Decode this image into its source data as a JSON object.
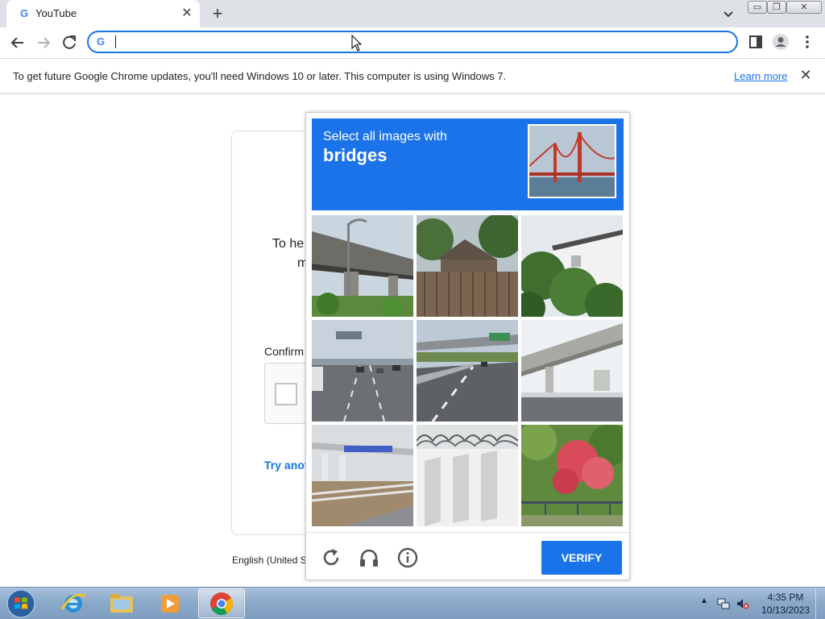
{
  "browser": {
    "tab": {
      "title": "YouTube",
      "favicon": "google-g-icon"
    },
    "window_controls": [
      "minimize",
      "restore",
      "close"
    ],
    "omnibox": {
      "value": "",
      "placeholder": ""
    }
  },
  "infobar": {
    "message": "To get future Google Chrome updates, you'll need Windows 10 or later. This computer is using Windows 7.",
    "learn_more": "Learn more"
  },
  "background_page": {
    "line1": "To he",
    "line2": "m",
    "confirm_label": "Confirm",
    "try_another": "Try anot",
    "footer_language": "English (United S"
  },
  "captcha": {
    "instruction": "Select all images with",
    "target": "bridges",
    "tiles": [
      {
        "subject": "highway overpass with lamp post"
      },
      {
        "subject": "wooden shed and fence with trees"
      },
      {
        "subject": "white house behind green shrubs"
      },
      {
        "subject": "multi-lane highway with traffic"
      },
      {
        "subject": "road under an overpass"
      },
      {
        "subject": "underside of a concrete overpass"
      },
      {
        "subject": "elevated roadway with railings"
      },
      {
        "subject": "concrete wall with barbed wire"
      },
      {
        "subject": "red flowering bush by a fence"
      }
    ],
    "footer": {
      "reload": "reload-icon",
      "audio": "headphones-icon",
      "info": "info-icon",
      "verify_label": "VERIFY"
    },
    "accent_color": "#1a73e8"
  },
  "taskbar": {
    "apps": [
      "internet-explorer-icon",
      "file-explorer-icon",
      "media-player-icon",
      "chrome-icon"
    ],
    "clock": {
      "time": "4:35 PM",
      "date": "10/13/2023"
    }
  }
}
